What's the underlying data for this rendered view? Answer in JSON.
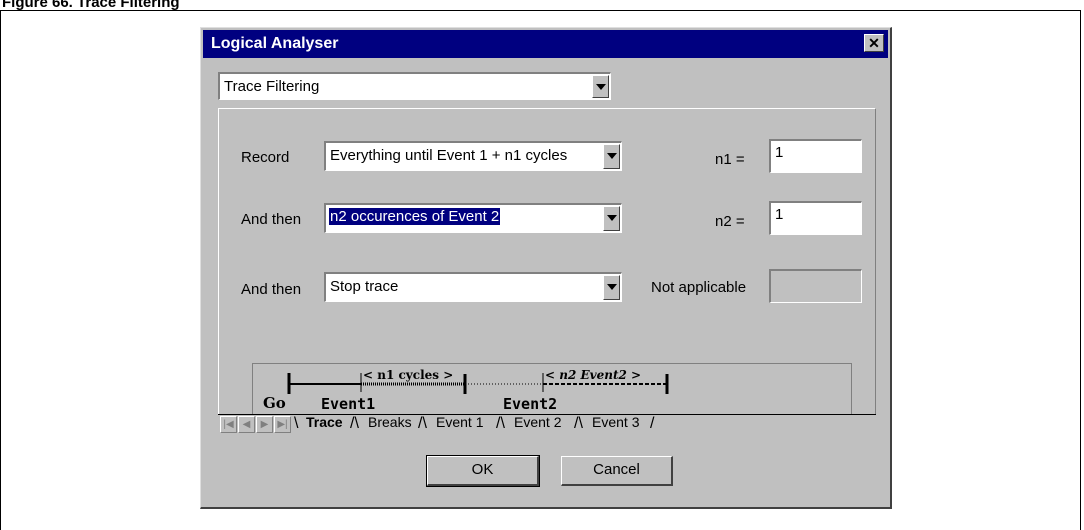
{
  "figure": {
    "caption": "Figure 66. Trace Filtering"
  },
  "dialog": {
    "title": "Logical Analyser",
    "close_symbol": "✕",
    "mode_select": "Trace Filtering",
    "rows": [
      {
        "label": "Record",
        "select": "Everything  until Event 1 + n1 cycles",
        "param_label": "n1 =",
        "param_value": "1"
      },
      {
        "label": "And then",
        "select": "n2 occurences of  Event 2",
        "param_label": "n2 =",
        "param_value": "1"
      },
      {
        "label": "And then",
        "select": "Stop trace",
        "param_label": "Not applicable",
        "param_value": ""
      }
    ],
    "timeline": {
      "go": "Go",
      "event1": "Event1",
      "event2": "Event2",
      "n1_cycles": "< n1 cycles >",
      "n2_event2": "< n2 Event2 >"
    },
    "tabs": [
      "Trace",
      "Breaks",
      "Event 1",
      "Event 2",
      "Event 3"
    ],
    "active_tab": "Trace",
    "buttons": {
      "ok": "OK",
      "cancel": "Cancel"
    }
  }
}
